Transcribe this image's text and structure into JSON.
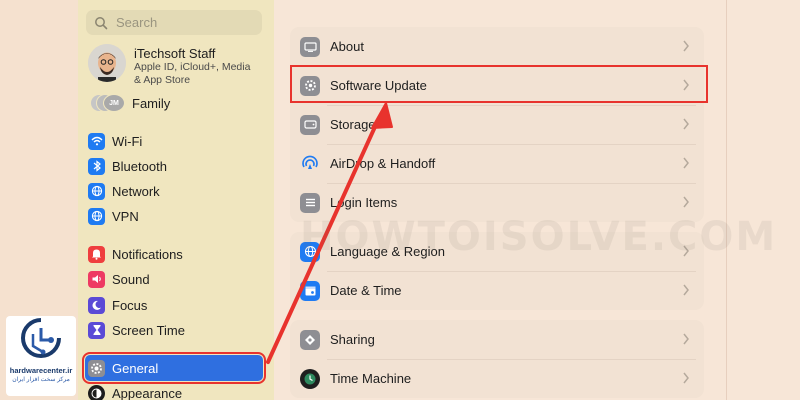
{
  "sidebar": {
    "search_placeholder": "Search",
    "profile": {
      "name": "iTechsoft Staff",
      "line1": "Apple ID, iCloud+, Media",
      "line2": "& App Store"
    },
    "family": {
      "avatar_initials": "JM",
      "label": "Family"
    },
    "items": [
      {
        "label": "Wi-Fi",
        "icon": "wifi-icon",
        "color": "#1f7bf2"
      },
      {
        "label": "Bluetooth",
        "icon": "bluetooth-icon",
        "color": "#1f7bf2"
      },
      {
        "label": "Network",
        "icon": "globe-icon",
        "color": "#1f7bf2"
      },
      {
        "label": "VPN",
        "icon": "vpn-globe-icon",
        "color": "#1f7bf2"
      },
      {
        "label": "Notifications",
        "icon": "bell-icon",
        "color": "#ef3e3e"
      },
      {
        "label": "Sound",
        "icon": "speaker-icon",
        "color": "#ee3a63"
      },
      {
        "label": "Focus",
        "icon": "moon-icon",
        "color": "#5b4ad6"
      },
      {
        "label": "Screen Time",
        "icon": "hourglass-icon",
        "color": "#5b4ad6"
      },
      {
        "label": "General",
        "icon": "gear-icon",
        "color": "#8e8e93",
        "selected": true
      },
      {
        "label": "Appearance",
        "icon": "appearance-icon",
        "color": "#1c1c1c"
      }
    ]
  },
  "main": {
    "group1": [
      {
        "label": "About",
        "icon": "about-icon",
        "color": "#8e8e93"
      },
      {
        "label": "Software Update",
        "icon": "software-update-icon",
        "color": "#8e8e93",
        "highlighted": true
      },
      {
        "label": "Storage",
        "icon": "storage-icon",
        "color": "#8e8e93"
      },
      {
        "label": "AirDrop & Handoff",
        "icon": "airdrop-icon",
        "color": "#1f7bf2"
      },
      {
        "label": "Login Items",
        "icon": "login-items-icon",
        "color": "#8e8e93"
      }
    ],
    "group2": [
      {
        "label": "Language & Region",
        "icon": "language-globe-icon",
        "color": "#1f7bf2"
      },
      {
        "label": "Date & Time",
        "icon": "calendar-icon",
        "color": "#1f7bf2"
      }
    ],
    "group3": [
      {
        "label": "Sharing",
        "icon": "sharing-icon",
        "color": "#8e8e93"
      },
      {
        "label": "Time Machine",
        "icon": "time-machine-icon",
        "color": "#2e8a5f"
      }
    ]
  },
  "watermark": "HOWTOISOLVE.COM",
  "logo": {
    "name": "hardwarecenter.ir",
    "tagline": "مرکز سخت افزار ایران"
  },
  "accent_color": "#e8332d"
}
